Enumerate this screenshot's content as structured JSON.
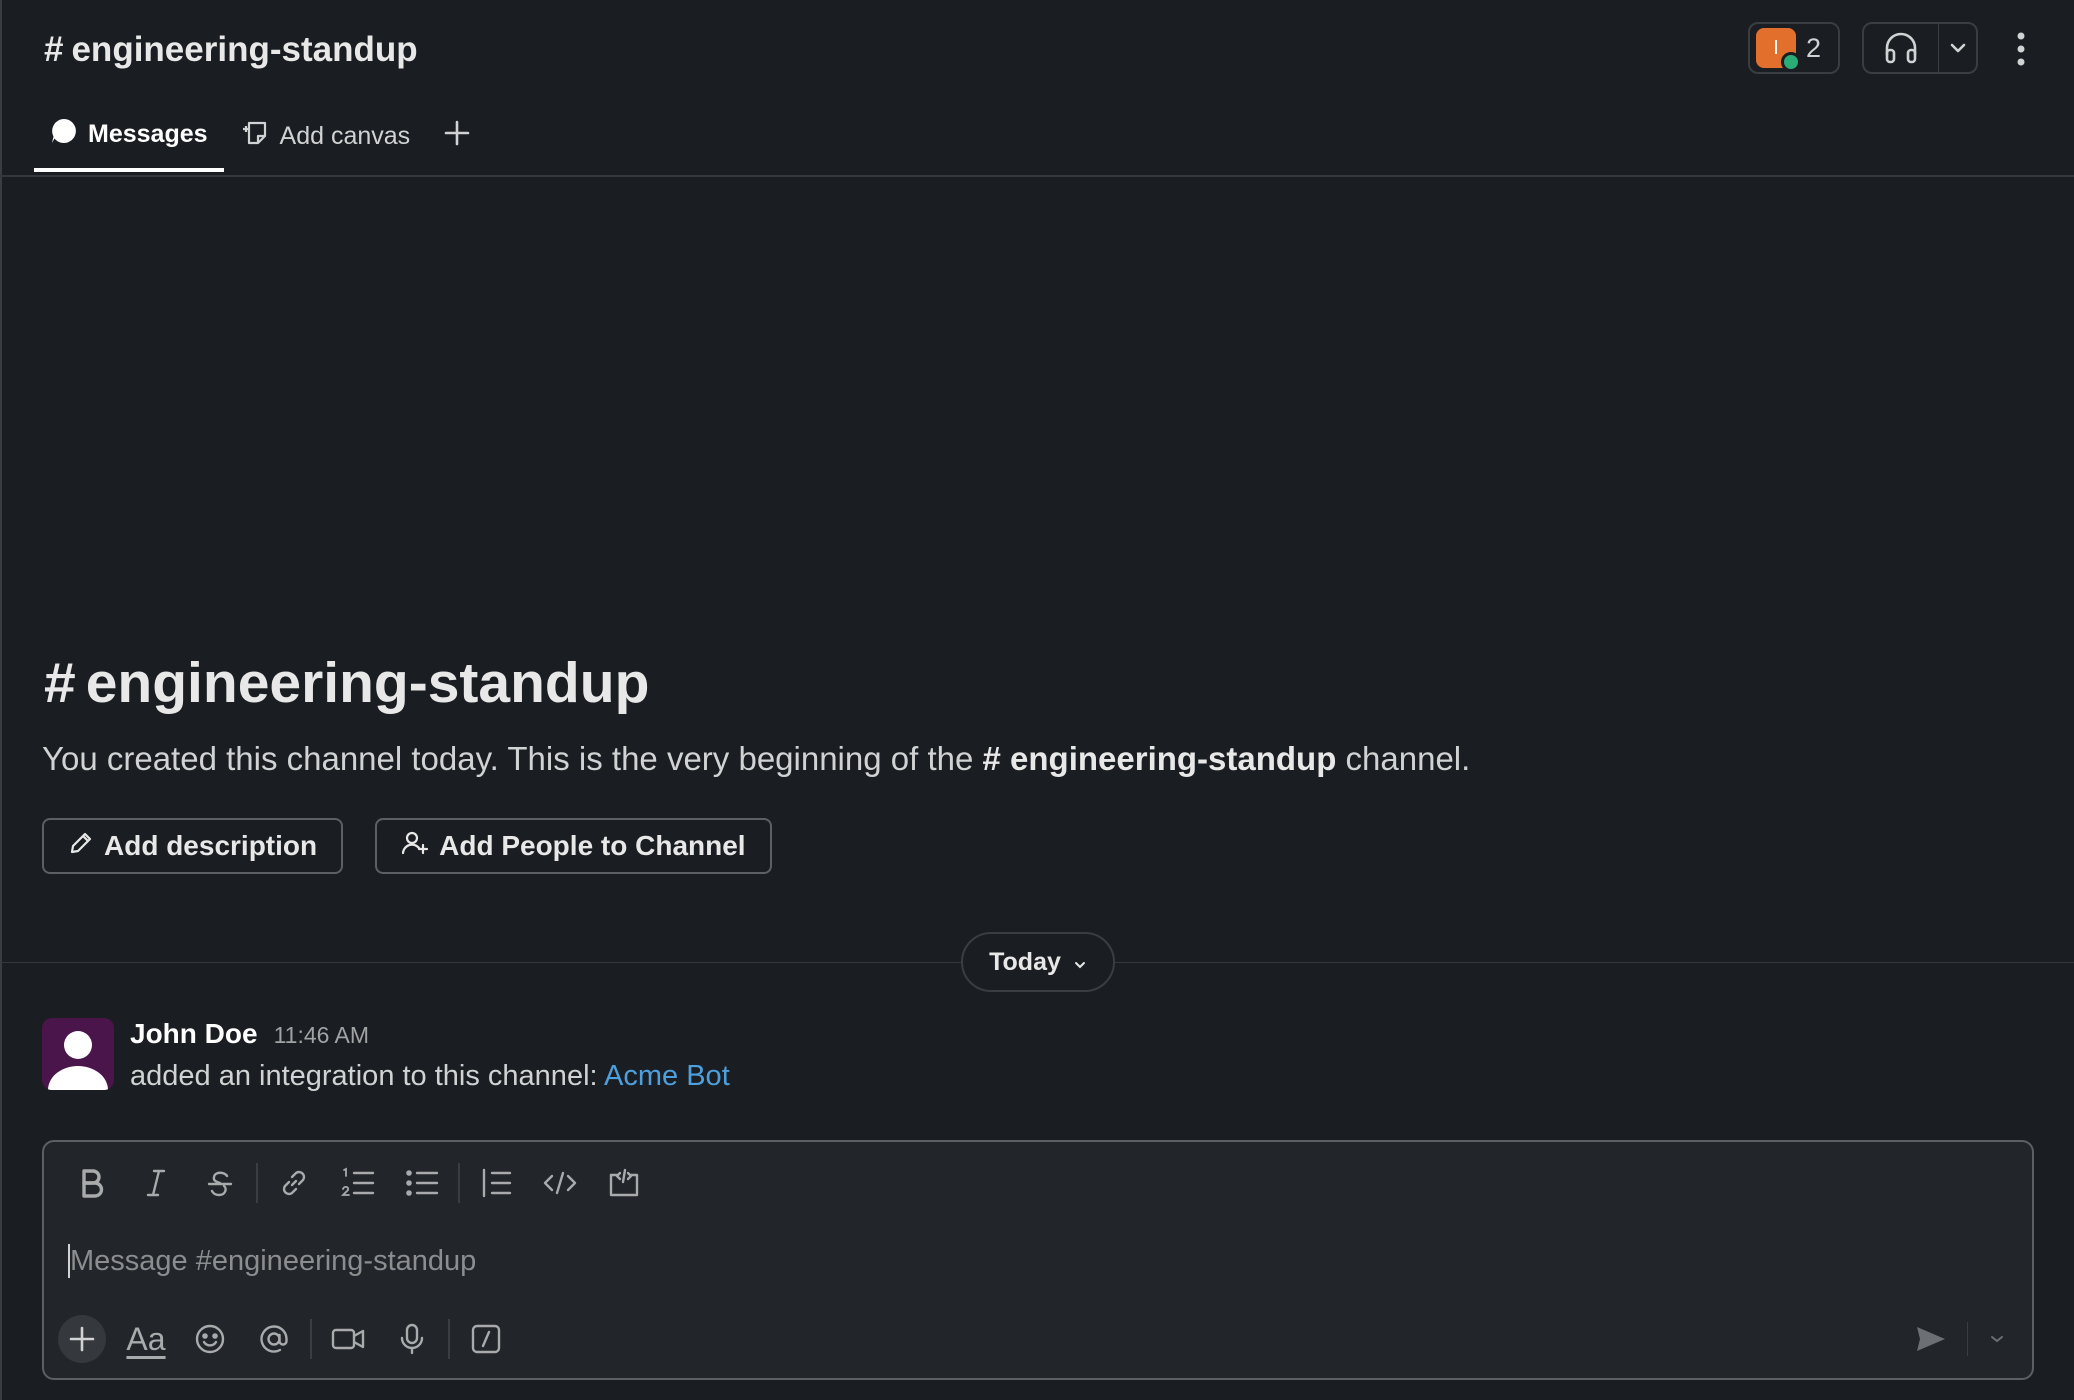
{
  "header": {
    "channel_name": "engineering-standup",
    "hash": "#",
    "huddle_member_initial": "I",
    "huddle_member_count": "2"
  },
  "tabs": [
    {
      "label": "Messages",
      "icon": "message-bubble-icon",
      "active": true
    },
    {
      "label": "Add canvas",
      "icon": "canvas-icon",
      "active": false
    },
    {
      "label": "",
      "icon": "plus-icon",
      "active": false
    }
  ],
  "intro": {
    "title": "engineering-standup",
    "text_before": "You created this channel today. This is the very beginning of the ",
    "channel_ref": "# engineering-standup",
    "text_after": " channel.",
    "add_description_label": "Add description",
    "add_people_label": "Add People to Channel"
  },
  "divider": {
    "label": "Today"
  },
  "message": {
    "sender": "John Doe",
    "time": "11:46 AM",
    "text": "added an integration to this channel: ",
    "link": "Acme Bot"
  },
  "composer": {
    "placeholder": "Message #engineering-standup",
    "format_buttons": [
      "bold-icon",
      "italic-icon",
      "strikethrough-icon",
      "link-icon",
      "ordered-list-icon",
      "bullet-list-icon",
      "blockquote-icon",
      "code-icon",
      "code-block-icon"
    ],
    "bottom_buttons": [
      "plus-icon",
      "formatting-icon",
      "emoji-icon",
      "mention-icon",
      "video-icon",
      "microphone-icon",
      "slash-command-icon"
    ],
    "formatting_label": "Aa"
  },
  "colors": {
    "background": "#1a1d21",
    "link": "#4e9fdd",
    "avatar_bg": "#4a154b",
    "member_avatar": "#e36f2c",
    "online": "#2bac76"
  }
}
